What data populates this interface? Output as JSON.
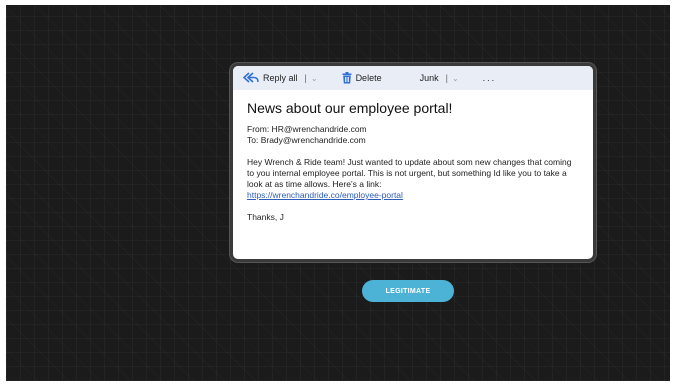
{
  "toolbar": {
    "reply_all_label": "Reply all",
    "reply_sep": "|",
    "delete_label": "Delete",
    "junk_label": "Junk",
    "junk_sep": "|",
    "more_label": "...",
    "caret": "⌄",
    "reply_icon": "reply-all-icon",
    "delete_icon": "trash-icon"
  },
  "email": {
    "subject": "News about our employee portal!",
    "from": "From: HR@wrenchandride.com",
    "to": "To: Brady@wrenchandride.com",
    "body_text": "Hey Wrench & Ride team! Just wanted to update about som new changes that coming to you internal employee portal. This is not urgent, but something Id like you to take a look at as time allows. Here’s a link:",
    "link": "https://wrenchandride.co/employee-portal",
    "signoff": "Thanks, J"
  },
  "action": {
    "button_label": "LEGITIMATE"
  },
  "colors": {
    "accent": "#4db3d6",
    "background": "#1b1b1b",
    "link": "#2c5bb8",
    "toolbar": "#e9eef6"
  }
}
